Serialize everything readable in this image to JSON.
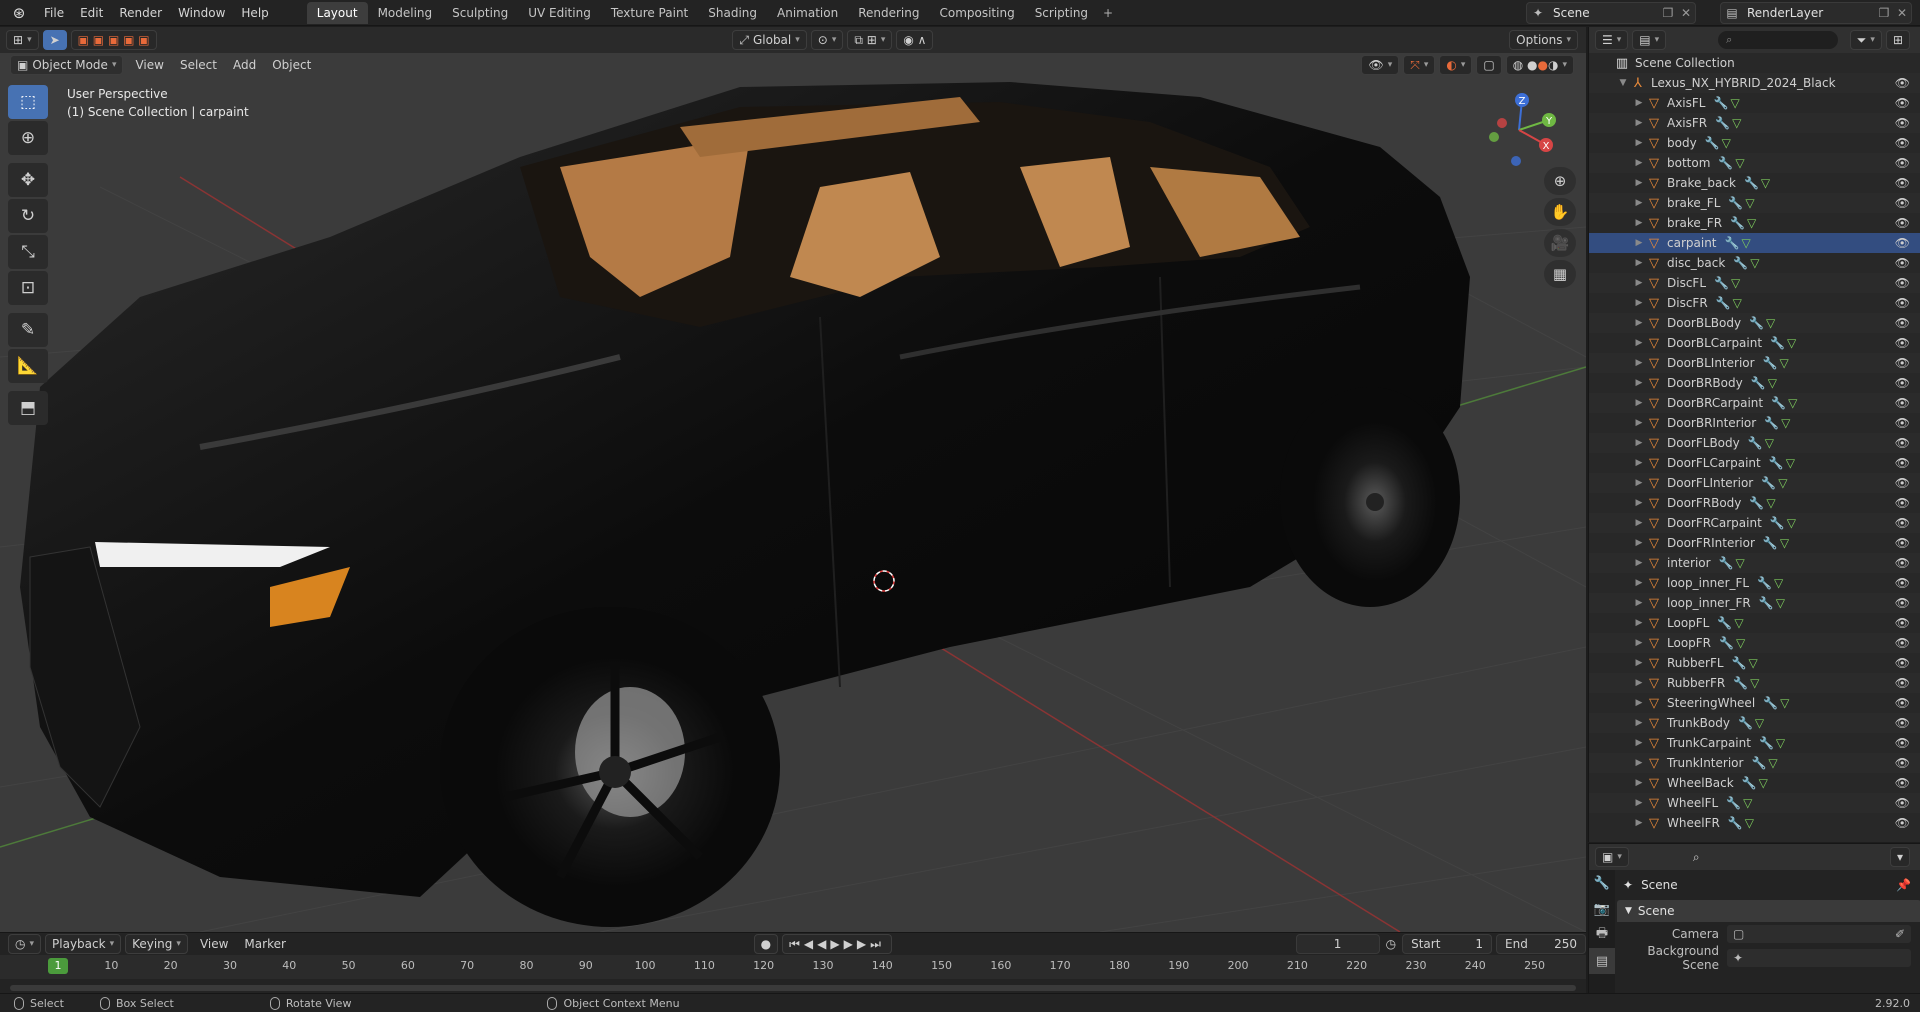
{
  "topbar": {
    "menus": [
      "File",
      "Edit",
      "Render",
      "Window",
      "Help"
    ],
    "workspaces": [
      "Layout",
      "Modeling",
      "Sculpting",
      "UV Editing",
      "Texture Paint",
      "Shading",
      "Animation",
      "Rendering",
      "Compositing",
      "Scripting"
    ],
    "active_workspace": "Layout",
    "add_tab": "+",
    "scene": "Scene",
    "view_layer": "RenderLayer"
  },
  "viewport": {
    "mode": "Object Mode",
    "menus": [
      "View",
      "Select",
      "Add",
      "Object"
    ],
    "transform_orientation": "Global",
    "options": "Options",
    "overlay_line1": "User Perspective",
    "overlay_line2": "(1) Scene Collection | carpaint",
    "gizmo": {
      "z": "Z",
      "y": "Y",
      "x": "X"
    }
  },
  "outliner": {
    "search_placeholder": "",
    "root": "Scene Collection",
    "collection": "Lexus_NX_HYBRID_2024_Black",
    "objects": [
      "AxisFL",
      "AxisFR",
      "body",
      "bottom",
      "Brake_back",
      "brake_FL",
      "brake_FR",
      "carpaint",
      "disc_back",
      "DiscFL",
      "DiscFR",
      "DoorBLBody",
      "DoorBLCarpaint",
      "DoorBLInterior",
      "DoorBRBody",
      "DoorBRCarpaint",
      "DoorBRInterior",
      "DoorFLBody",
      "DoorFLCarpaint",
      "DoorFLInterior",
      "DoorFRBody",
      "DoorFRCarpaint",
      "DoorFRInterior",
      "interior",
      "loop_inner_FL",
      "loop_inner_FR",
      "LoopFL",
      "LoopFR",
      "RubberFL",
      "RubberFR",
      "SteeringWheel",
      "TrunkBody",
      "TrunkCarpaint",
      "TrunkInterior",
      "WheelBack",
      "WheelFL",
      "WheelFR"
    ],
    "selected": "carpaint"
  },
  "properties": {
    "title": "Scene",
    "panel": "Scene",
    "camera_label": "Camera",
    "background_label": "Background Scene"
  },
  "timeline": {
    "menus": [
      "Playback",
      "Keying",
      "View",
      "Marker"
    ],
    "current_frame": "1",
    "start_label": "Start",
    "start": "1",
    "end_label": "End",
    "end": "250",
    "ticks": [
      "10",
      "20",
      "30",
      "40",
      "50",
      "60",
      "70",
      "80",
      "90",
      "100",
      "110",
      "120",
      "130",
      "140",
      "150",
      "160",
      "170",
      "180",
      "190",
      "200",
      "210",
      "220",
      "230",
      "240",
      "250"
    ],
    "playhead": "1"
  },
  "statusbar": {
    "select": "Select",
    "box_select": "Box Select",
    "rotate_view": "Rotate View",
    "context_menu": "Object Context Menu",
    "version": "2.92.0"
  },
  "colors": {
    "accent": "#4772b3",
    "object_icon": "#e88a3a",
    "frame_green": "#4b9b3c"
  }
}
